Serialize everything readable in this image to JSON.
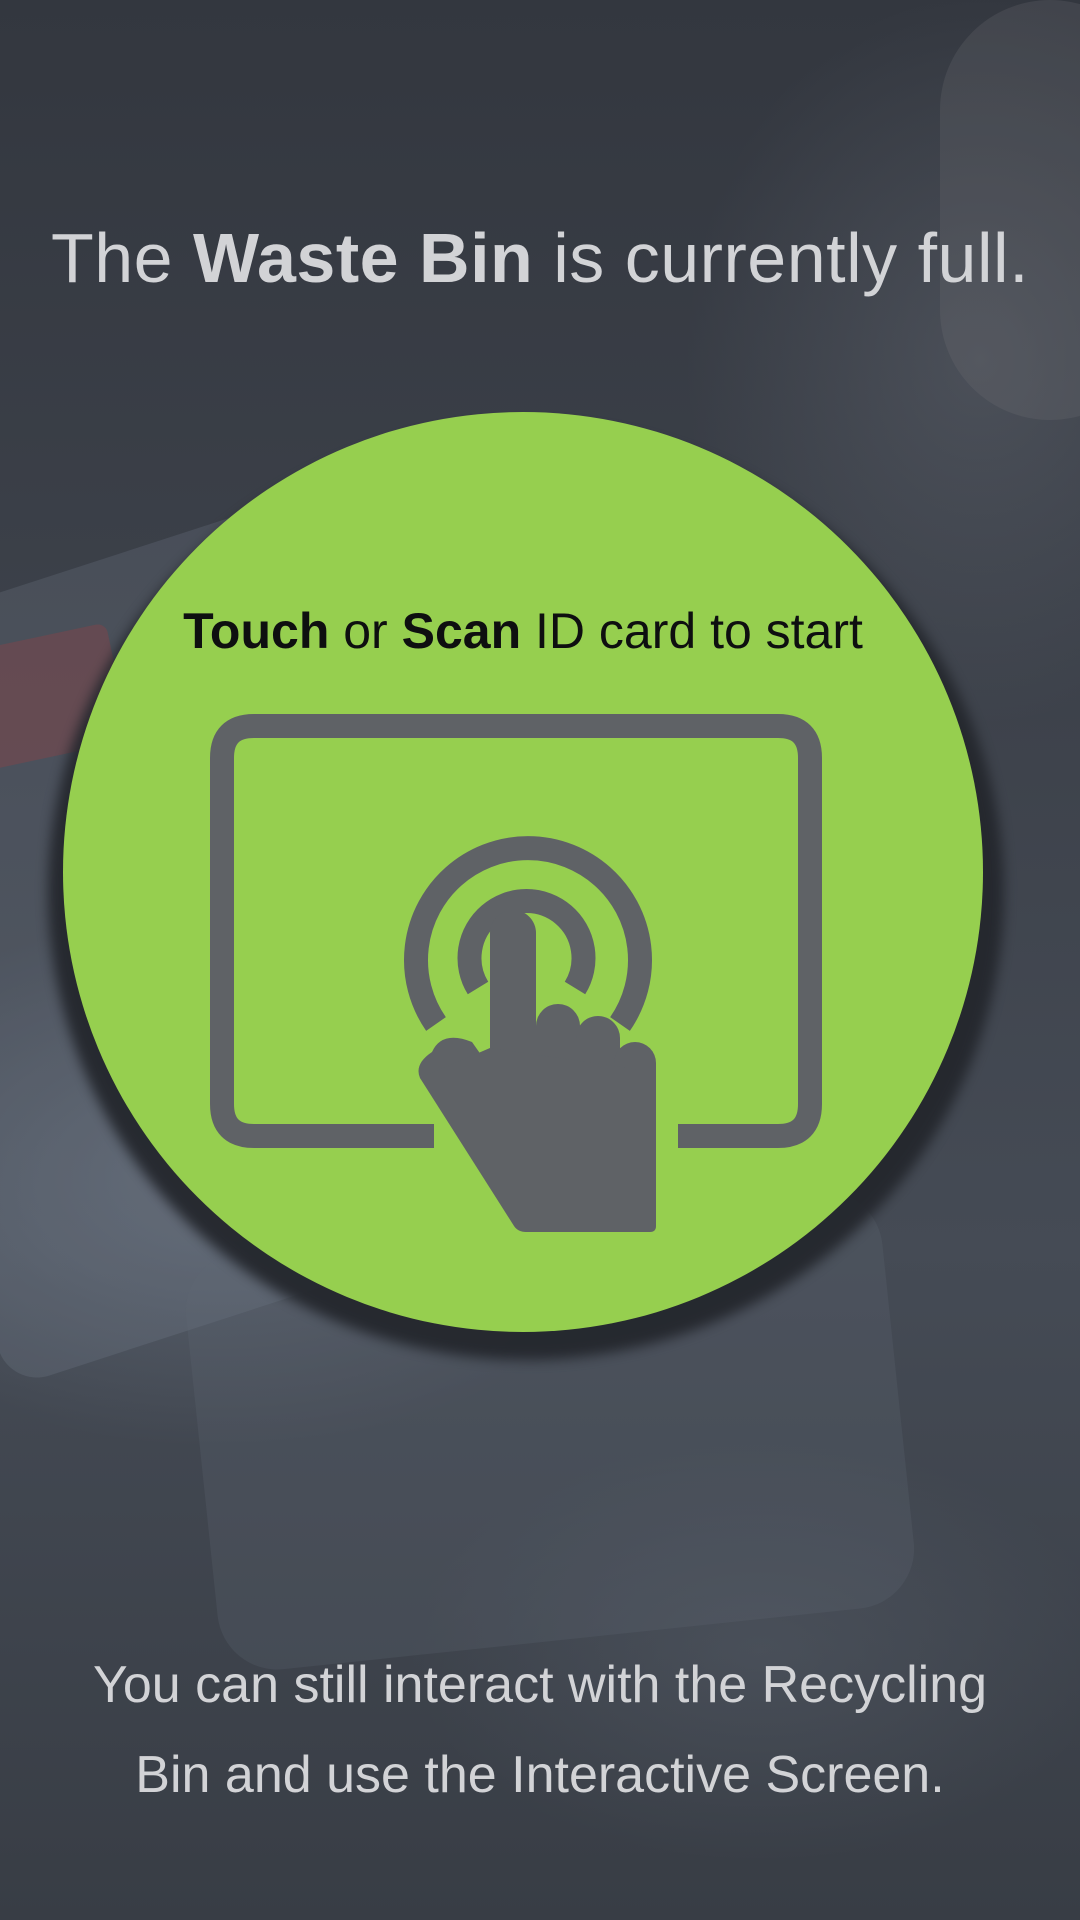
{
  "headline": {
    "prefix": "The ",
    "emphasis": "Waste Bin",
    "suffix": " is currently full."
  },
  "prompt": {
    "touch": "Touch",
    "or": " or ",
    "scan": "Scan",
    "rest": " ID card to start"
  },
  "icon": {
    "name": "touch-screen-icon",
    "color": "#5f6266"
  },
  "colors": {
    "circle": "#96cf4f",
    "text_light": "#d2d3d6",
    "text_dark": "#0e0f10"
  },
  "footer": {
    "line1": "You can still interact with the Recycling",
    "line2": "Bin and use the Interactive Screen."
  }
}
